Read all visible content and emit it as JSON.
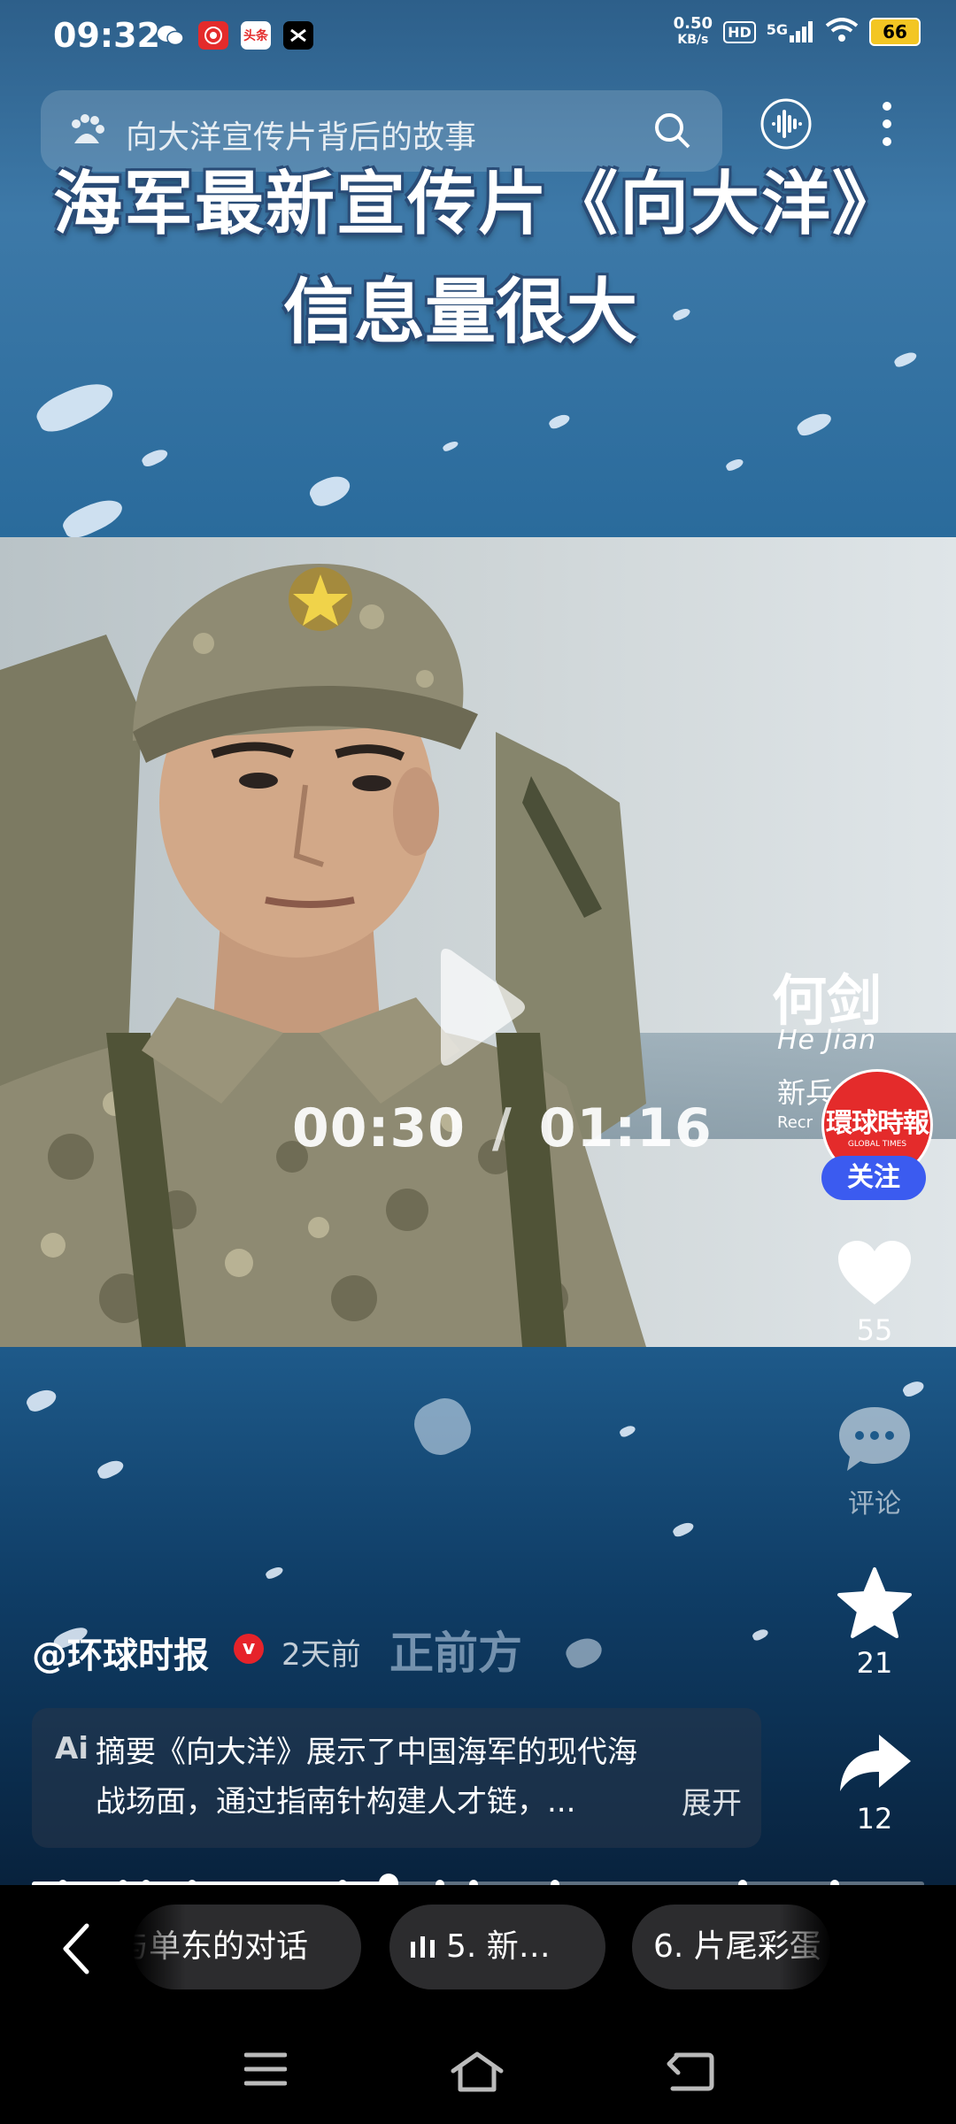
{
  "status_bar": {
    "time": "09:32",
    "net_speed": "0.50",
    "net_unit": "KB/s",
    "hd": "HD",
    "signal": "5G",
    "battery": "66",
    "app_icons": [
      "wechat-icon",
      "red-app-icon",
      "toutiao-icon",
      "capcut-icon"
    ]
  },
  "search": {
    "query": "向大洋宣传片背后的故事"
  },
  "video": {
    "overlay_title_line1": "海军最新宣传片《向大洋》",
    "overlay_title_line2": "信息量很大",
    "current_time": "00:30",
    "separator": "/",
    "duration": "01:16",
    "caption_name": "何剑",
    "caption_pinyin": "He Jian",
    "caption_role": "新兵",
    "caption_sub": "Recr",
    "watermark": "正前方"
  },
  "creator": {
    "avatar_text": "環球時報",
    "avatar_sub": "GLOBAL TIMES",
    "follow_label": "关注",
    "handle": "@环球时报",
    "verified_mark": "v",
    "posted": "2天前"
  },
  "actions": {
    "likes": "55",
    "comments_label": "评论",
    "favorites": "21",
    "shares": "12"
  },
  "summary": {
    "ai_label": "Ai",
    "text": "摘要《向大洋》展示了中国海军的现代海战场面，通过指南针构建人才链，...",
    "expand_label": "展开"
  },
  "progress": {
    "fraction": 0.4
  },
  "chapters": {
    "items": [
      "与单东的对话",
      "5. 新…",
      "6. 片尾彩蛋"
    ]
  },
  "colors": {
    "follow_button": "#3b5bf0",
    "verified": "#e6232a",
    "battery": "#f3c623",
    "avatar": "#e42b2b"
  }
}
